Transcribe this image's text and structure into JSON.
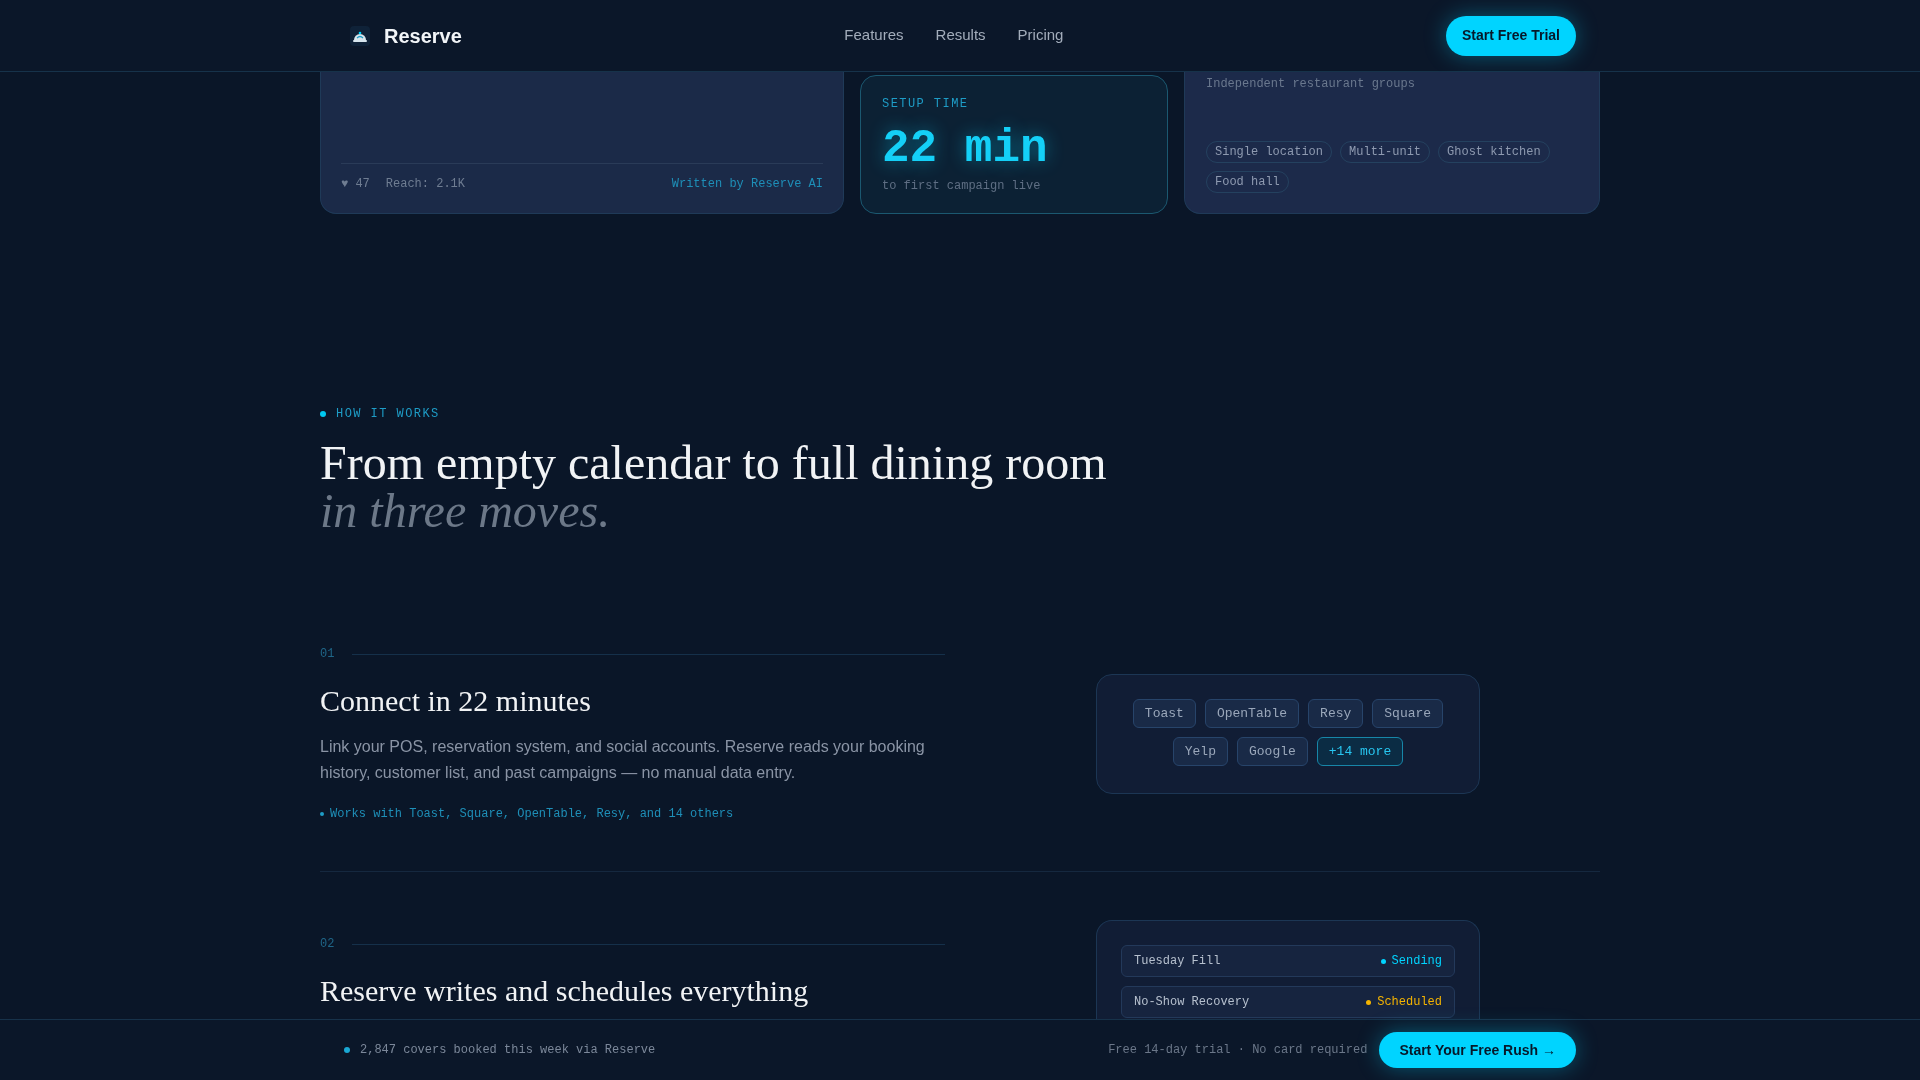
{
  "nav": {
    "brand": "Reserve",
    "links": [
      "Features",
      "Results",
      "Pricing"
    ],
    "cta": "Start Free Trial"
  },
  "top_cards": {
    "post_card": {
      "likes": "♥ 47",
      "reach": "Reach: 2.1K",
      "credit": "Written by Reserve AI"
    },
    "stat_card": {
      "label": "SETUP TIME",
      "value": "22 min",
      "caption": "to first campaign live"
    },
    "segments_card": {
      "caption": "Independent restaurant groups",
      "tags": [
        "Single location",
        "Multi-unit",
        "Ghost kitchen",
        "Food hall"
      ]
    }
  },
  "how_it_works": {
    "eyebrow": "HOW IT WORKS",
    "heading": "From empty calendar to full dining room",
    "heading_italic": "in three moves.",
    "steps": [
      {
        "number": "01",
        "title": "Connect in 22 minutes",
        "body": "Link your POS, reservation system, and social accounts. Reserve reads your booking history, customer list, and past campaigns — no manual data entry.",
        "note": "Works with Toast, Square, OpenTable, Resy, and 14 others",
        "panel": {
          "kind": "chips",
          "chips": [
            {
              "label": "Toast",
              "kind": "platform"
            },
            {
              "label": "OpenTable",
              "kind": "platform"
            },
            {
              "label": "Resy",
              "kind": "platform"
            },
            {
              "label": "Square",
              "kind": "platform"
            },
            {
              "label": "Yelp",
              "kind": "platform"
            },
            {
              "label": "Google",
              "kind": "platform"
            },
            {
              "label": "+14 more",
              "kind": "more"
            }
          ]
        }
      },
      {
        "number": "02",
        "title": "Reserve writes and schedules everything",
        "panel": {
          "kind": "campaigns",
          "rows": [
            {
              "name": "Tuesday Fill",
              "status": "Sending",
              "color": "#00d4ff"
            },
            {
              "name": "No-Show Recovery",
              "status": "Scheduled",
              "color": "#f5b400"
            }
          ]
        }
      }
    ]
  },
  "bottom_bar": {
    "stat": "2,847 covers booked this week via Reserve",
    "note": "Free 14-day trial · No card required",
    "cta": "Start Your Free Rush →"
  }
}
